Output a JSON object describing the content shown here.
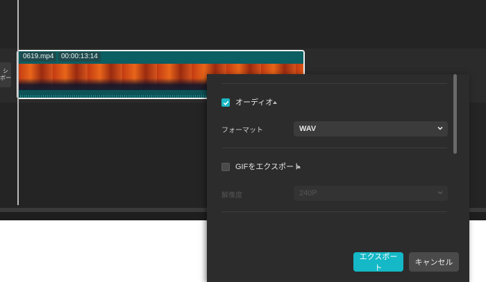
{
  "timeline": {
    "clip_filename": "0619.mp4",
    "clip_duration": "00:00:13:14",
    "side_button_text": [
      "シ",
      "ボー"
    ]
  },
  "export_dialog": {
    "audio_section": {
      "title": "オーディオ",
      "checked": true,
      "format_label": "フォーマット",
      "format_value": "WAV"
    },
    "gif_section": {
      "title": "GIFをエクスポート",
      "checked": false,
      "resolution_label": "解像度",
      "resolution_value": "240P"
    },
    "buttons": {
      "export": "エクスポート",
      "cancel": "キャンセル"
    }
  },
  "colors": {
    "accent": "#14b8c6",
    "dialog_bg": "#2c2c2c",
    "app_bg": "#242424"
  }
}
